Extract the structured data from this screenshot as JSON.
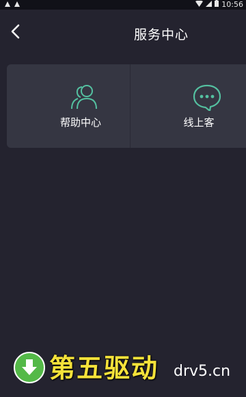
{
  "status_bar": {
    "time": "10:56"
  },
  "header": {
    "title": "服务中心"
  },
  "services": {
    "items": [
      {
        "label": "帮助中心",
        "icon": "people-icon"
      },
      {
        "label": "线上客",
        "icon": "chat-bubble-icon"
      }
    ]
  },
  "watermark": {
    "brand": "第五驱动",
    "domain": "drv5.cn"
  },
  "colors": {
    "background": "#24232f",
    "card": "#353642",
    "accent": "#54c0a0",
    "watermark_yellow": "#f5e23a",
    "watermark_green": "#54b948"
  }
}
